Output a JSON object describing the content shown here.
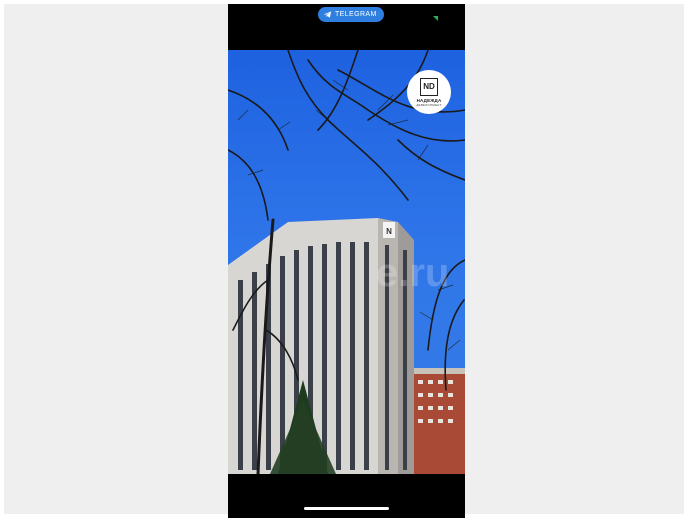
{
  "top_bar": {
    "telegram_label": "TELEGRAM",
    "telegram_icon": "paper-plane-icon",
    "accent": "#2f7fe0"
  },
  "video": {
    "logo_monogram": "ND",
    "logo_name": "НАДЕЖДА",
    "logo_sub": "ДЕВЕЛОПМЕНТ",
    "watermark": "e.ru",
    "sky_color": "#2a6ee6"
  }
}
